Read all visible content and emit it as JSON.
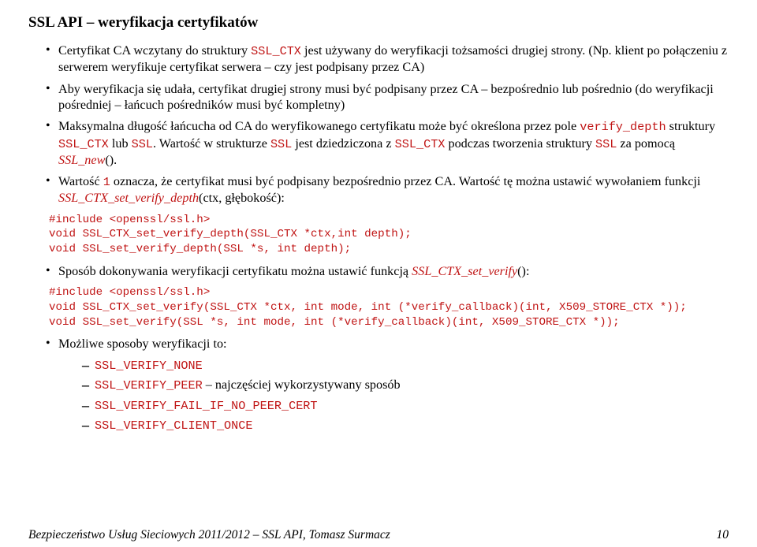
{
  "title": "SSL API – weryfikacja certyfikatów",
  "bullets": {
    "b1_a": "Certyfikat CA wczytany do struktury ",
    "b1_code": "SSL_CTX",
    "b1_b": " jest używany do weryfikacji tożsamości drugiej strony. (Np. klient po połączeniu z serwerem weryfikuje certyfikat serwera – czy jest podpisany przez CA)",
    "b2": "Aby weryfikacja się udała, certyfikat drugiej strony musi być podpisany przez CA – bezpośrednio lub pośrednio (do weryfikacji pośredniej – łańcuch pośredników musi być kompletny)",
    "b3_a": "Maksymalna długość łańcucha od CA do weryfikowanego certyfikatu może być określona przez pole ",
    "b3_code1": "verify_depth",
    "b3_b": " struktury ",
    "b3_code2": "SSL_CTX",
    "b3_c": " lub ",
    "b3_code3": "SSL",
    "b3_d": ". Wartość w strukturze ",
    "b3_code4": "SSL",
    "b3_e": " jest dziedziczona z ",
    "b3_code5": "SSL_CTX",
    "b3_f": " podczas tworzenia struktury ",
    "b3_code6": "SSL",
    "b3_g": " za pomocą ",
    "b3_fn1": "SSL_new",
    "b3_paren": "()",
    "b3_h": ".",
    "b4_a": "Wartość ",
    "b4_code1": "1",
    "b4_b": " oznacza, że certyfikat musi być podpisany bezpośrednio przez CA. Wartość tę można ustawić wywołaniem funkcji ",
    "b4_fn": "SSL_CTX_set_verify_depth",
    "b4_paren_open": "(",
    "b4_arg1": "ctx",
    "b4_sep": ", ",
    "b4_arg2": "głębokość",
    "b4_paren_close": ")",
    "b4_c": ":",
    "b5_a": "Sposób dokonywania weryfikacji certyfikatu można ustawić funkcją ",
    "b5_fn": "SSL_CTX_set_verify",
    "b5_paren": "()",
    "b5_c": ":",
    "b6": "Możliwe sposoby weryfikacji to:"
  },
  "code1": "#include <openssl/ssl.h>\nvoid SSL_CTX_set_verify_depth(SSL_CTX *ctx,int depth);\nvoid SSL_set_verify_depth(SSL *s, int depth);",
  "code2": "#include <openssl/ssl.h>\nvoid SSL_CTX_set_verify(SSL_CTX *ctx, int mode, int (*verify_callback)(int, X509_STORE_CTX *));\nvoid SSL_set_verify(SSL *s, int mode, int (*verify_callback)(int, X509_STORE_CTX *));",
  "sub": {
    "s1": "SSL_VERIFY_NONE",
    "s2": "SSL_VERIFY_PEER",
    "s2_tail": " – najczęściej wykorzystywany sposób",
    "s3": "SSL_VERIFY_FAIL_IF_NO_PEER_CERT",
    "s4": "SSL_VERIFY_CLIENT_ONCE"
  },
  "footer": {
    "left": "Bezpieczeństwo Usług Sieciowych 2011/2012 – SSL API, Tomasz Surmacz",
    "right": "10"
  }
}
